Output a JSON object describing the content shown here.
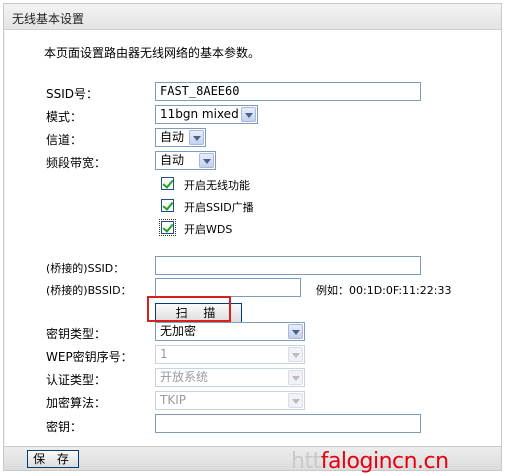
{
  "page": {
    "title": "无线基本设置",
    "description": "本页面设置路由器无线网络的基本参数。"
  },
  "form": {
    "ssid_label": "SSID号：",
    "ssid_value": "FAST_8AEE60",
    "mode_label": "模式：",
    "mode_value": "11bgn mixed",
    "channel_label": "信道：",
    "channel_value": "自动",
    "bandwidth_label": "频段带宽：",
    "bandwidth_value": "自动",
    "enable_wireless_label": "开启无线功能",
    "enable_ssid_broadcast_label": "开启SSID广播",
    "enable_wds_label": "开启WDS",
    "bridge_ssid_label": "(桥接的)SSID：",
    "bridge_ssid_value": "",
    "bridge_bssid_label": "(桥接的)BSSID：",
    "bridge_bssid_value": "",
    "bssid_example": "例如：00:1D:0F:11:22:33",
    "scan_button": "扫 描",
    "key_type_label": "密钥类型：",
    "key_type_value": "无加密",
    "wep_index_label": "WEP密钥序号：",
    "wep_index_value": "1",
    "auth_type_label": "认证类型：",
    "auth_type_value": "开放系统",
    "encryption_label": "加密算法：",
    "encryption_value": "TKIP",
    "key_label": "密钥：",
    "key_value": ""
  },
  "footer": {
    "save_button": "保 存"
  },
  "watermark": {
    "prefix": "htt",
    "text": "falogincn.cn"
  },
  "colors": {
    "highlight": "#d82020",
    "check": "#21a121",
    "watermark": "#e60012"
  }
}
